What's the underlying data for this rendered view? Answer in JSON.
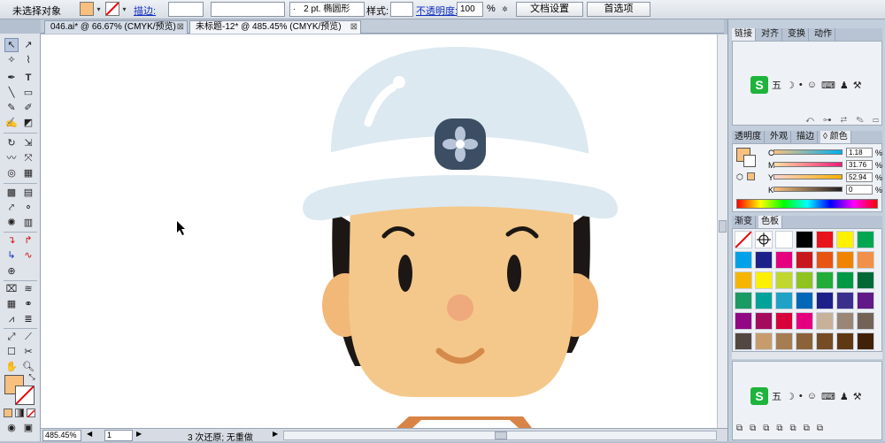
{
  "control_bar": {
    "selection_status": "未选择对象",
    "stroke_label": "描边:",
    "stroke_width": "",
    "brush_dot": "·",
    "brush_value": "2 pt. 椭圆形",
    "style_label": "样式:",
    "opacity_label": "不透明度:",
    "opacity_value": "100",
    "opacity_unit": "%",
    "doc_setup": "文档设置",
    "preferences": "首选项"
  },
  "tabs": [
    {
      "label": "046.ai* @ 66.67% (CMYK/预览)",
      "close": "⊠"
    },
    {
      "label": "未标题-12* @ 485.45% (CMYK/预览)",
      "close": "⊠"
    }
  ],
  "status": {
    "zoom": "485.45%",
    "page": "1",
    "history": "3 次还原; 无重做",
    "arrow_left": "◀",
    "arrow_right": "▶"
  },
  "panels": {
    "group1_tabs": [
      "链接",
      "对齐",
      "变换",
      "动作"
    ],
    "ime": {
      "logo": "S",
      "items": [
        "五",
        "☽",
        "•",
        "☺",
        "⌨",
        "♟",
        "⚒"
      ]
    },
    "group2_tabs": [
      "透明度",
      "外观",
      "描边",
      "◊ 颜色"
    ],
    "cmyk": [
      {
        "label": "C",
        "value": "1.18",
        "unit": "%"
      },
      {
        "label": "M",
        "value": "31.76",
        "unit": "%"
      },
      {
        "label": "Y",
        "value": "52.94",
        "unit": "%"
      },
      {
        "label": "K",
        "value": "0",
        "unit": "%"
      }
    ],
    "group3_tabs": [
      "渐变",
      "色板"
    ],
    "swatches": [
      "none",
      "registration",
      "#ffffff",
      "#000000",
      "#e8141c",
      "#fff100",
      "#00a650",
      "#00a1e9",
      "#1d2088",
      "#e4007f",
      "#c9171e",
      "#e85412",
      "#f08300",
      "#f19149",
      "#f6b500",
      "#fcf000",
      "#c1d72f",
      "#8fc31f",
      "#22ac38",
      "#009944",
      "#006934",
      "#1a9b64",
      "#00a29a",
      "#1fa2c6",
      "#0068b7",
      "#1d2088",
      "#3b2f8e",
      "#601986",
      "#920783",
      "#a40b5d",
      "#d7003a",
      "#e4007f",
      "#c7b299",
      "#998675",
      "#736357",
      "#534741",
      "#c69c6d",
      "#a67c52",
      "#8c6239",
      "#754c24",
      "#603813",
      "#42210b"
    ],
    "ime2": {
      "logo": "S",
      "items": [
        "五",
        "☽",
        "•",
        "☺",
        "⌨",
        "♟",
        "⚒"
      ]
    }
  },
  "colors": {
    "fill": "#f7c07e",
    "helmet": "#dce9f1",
    "helmet_band": "#ffffff",
    "skin": "#f4c88a",
    "ear": "#f2b877",
    "hair": "#1c1714",
    "emblem": "#3b4e63",
    "mouth": "#d48a4a",
    "nose": "#eea97c",
    "collar": "#d88446"
  }
}
